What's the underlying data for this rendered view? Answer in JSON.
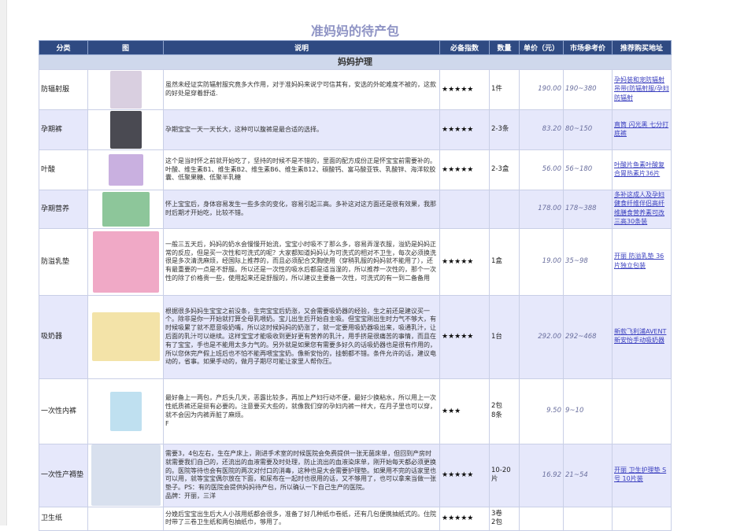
{
  "title": "准妈妈的待产包",
  "columns": [
    "分类",
    "图",
    "说明",
    "必备指数",
    "数量",
    "单价（元）",
    "市场参考价",
    "推荐购买地址"
  ],
  "section": "妈妈护理",
  "rows": [
    {
      "category": "防辐射服",
      "description": "虽然未经证实防辐射服究竟多大作用，对于准妈妈来说宁可信其有，安选的外蛇难度不被的，这款的好处是穿着舒适.",
      "stars": "★★★★★",
      "qty": "1件",
      "price": "190.00",
      "range": "190~380",
      "link": "孕妈装和宠防辐射吊带(防辐射服/孕妇防辐射",
      "img_color": "#d9cfe0"
    },
    {
      "category": "孕期裤",
      "description": "孕期宝宝一天一天长大，这种可以腹裤是最合适的选择。",
      "stars": "★★★★★",
      "qty": "2-3条",
      "price": "83.20",
      "range": "80~150",
      "link": "直筒 闪光黑 七分打底裤",
      "img_color": "#4a4a52"
    },
    {
      "category": "叶酸",
      "description": "这个是当时怀之前就开始吃了，坚持的时候不是不错的，里面的配方成份正是怀宝宝前需要补的。叶酸、维生素B1、维生素B2、维生素B6、维生素B12、碳酸钙、富马酸亚铁、乳酸锌、海洋软胶囊、低聚果糖、低聚半乳糖",
      "stars": "★★★★★",
      "qty": "2-3盒",
      "price": "56.00",
      "range": "56~180",
      "link": "叶酸片鱼素叶酸复合胃热素片36片",
      "img_color": "#c9b0e0"
    },
    {
      "category": "孕期营养",
      "description": "怀上宝宝后，身体容易发生一些多余的变化，容易引起三高。多补这对这方面还是很有效果，我那时后期才开始吃，比较不错。",
      "stars": "",
      "qty": "",
      "price": "178.00",
      "range": "178~388",
      "link": "多补这成人及孕妇健食纤维伴侣高纤维膳食营养素可改三高30条装",
      "img_color": "#8dc69a"
    },
    {
      "category": "防溢乳垫",
      "description": "一般三五天后，妈妈的奶水会慢慢开始流，宝宝小时吸不了那么多，容易弄湿衣服，溢奶是妈妈正常的反应，但是买一次性和可洗式的呢？大家都知道妈妈认为可洗式的相对不卫生，每次必须换洗很是多次清洗麻烦，经国际上推荐的，而且必须配合文胸使用（穿稍乳服的妈妈就不能用了），还有最重要的一点是不舒服。所以还是一次性的吸水后都是适当湿的，所以推荐一次性的，那个一次性的除了价格贵一些，使用起来还是舒服的，所以建议主要备一次性，可洗式的有一到二备备用",
      "stars": "★★★★★",
      "qty": "1盒",
      "price": "19.00",
      "range": "35~98",
      "link": "开丽 防溢乳垫 36片独立包装",
      "img_color": "#f0a9c6"
    },
    {
      "category": "吸奶器",
      "description": "根据很多妈妈生宝宝之前没条，生完宝宝后奶涨，又会需要吸奶器的经验，生之前还是建议买一个。除非是你一开始就打算全母乳喂奶。宝儿出生后开始自主吸。但宝宝刚出生时力气不够大，有时候吸累了就不愿意吸奶嘴，所以这时候妈妈的奶涨了，就一定要用吸奶器吸出来，吸通乳汁，让后面的乳汁可以继续。这样宝宝才能吸收到更好更有营养的乳汁，用手挤是很痛苦的事情，而且在有了宝宝，手也是不能用太多力气的。另外就是如果您有需要多好久的话吸奶器也是很有作用的，所以您休完产假上班后也不怕不能再喂宝宝奶。像新安怡的，挂朝都不错。条件允许的话，建议电动的，省事。如果手动的，做月子期尽可能让家里人帮你压。",
      "stars": "★★★★★",
      "qty": "1台",
      "price": "292.00",
      "range": "292~468",
      "link": "新款飞利浦AVENT新安怡手动吸奶器",
      "img_color": "#f3e3a8"
    },
    {
      "category": "一次性内裤",
      "description": "最好备上一两包，产后头几天，恶露比较多，再加上产妇行动不便，最好少换粘水，所以用上一次性纸质裤还是挺有必要的。注意要买大些的，就像我们穿的孕妇内裤一样大，在月子里也可以穿，就不会因为内裤弄脏了麻烦。\nF",
      "stars": "★★★",
      "qty": "2包\n8条",
      "price": "9.50",
      "range": "9~10",
      "link": "",
      "img_color": "#bfe0f0"
    },
    {
      "category": "一次性产褥垫",
      "description": "需要3，4包左右，生在产床上，刚进手术室的时候医院会免费提供一张无菌床单，但回到产房时就需要我们自己的，还流出的血液需要及时处理，防止流出的血液染床单，刚开始每天都必须更换的。医院等待也会有医院的两次对付口的消毒，这种也是大会需要护理垫。如果用不完的话家里也可以用，就等宝宝偶尔放在下面，和尿布在一起时也很用的话，又不够用了，也可以拿来当做一张垫子。PS：有的医院会提供妈妈待产包，所以确认一下自己生产的医院。\n品牌：开丽，三洋",
      "stars": "★★★★★",
      "qty": "10-20片",
      "price": "16.92",
      "range": "21~54",
      "link": "开丽 卫生护理垫 S号 10片装",
      "img_color": "#d8e0ee"
    },
    {
      "category": "卫生纸",
      "description": "分娩后宝宝出生后大人小孩用纸都会很多，准备了好几种纸巾卷纸，还有几包便携抽纸式的。住院时带了三卷卫生纸和两包抽纸巾，够用了。",
      "stars": "★★★★★",
      "qty": "3卷\n2包",
      "price": "",
      "range": "",
      "link": "",
      "img_color": "#ffffff"
    }
  ]
}
